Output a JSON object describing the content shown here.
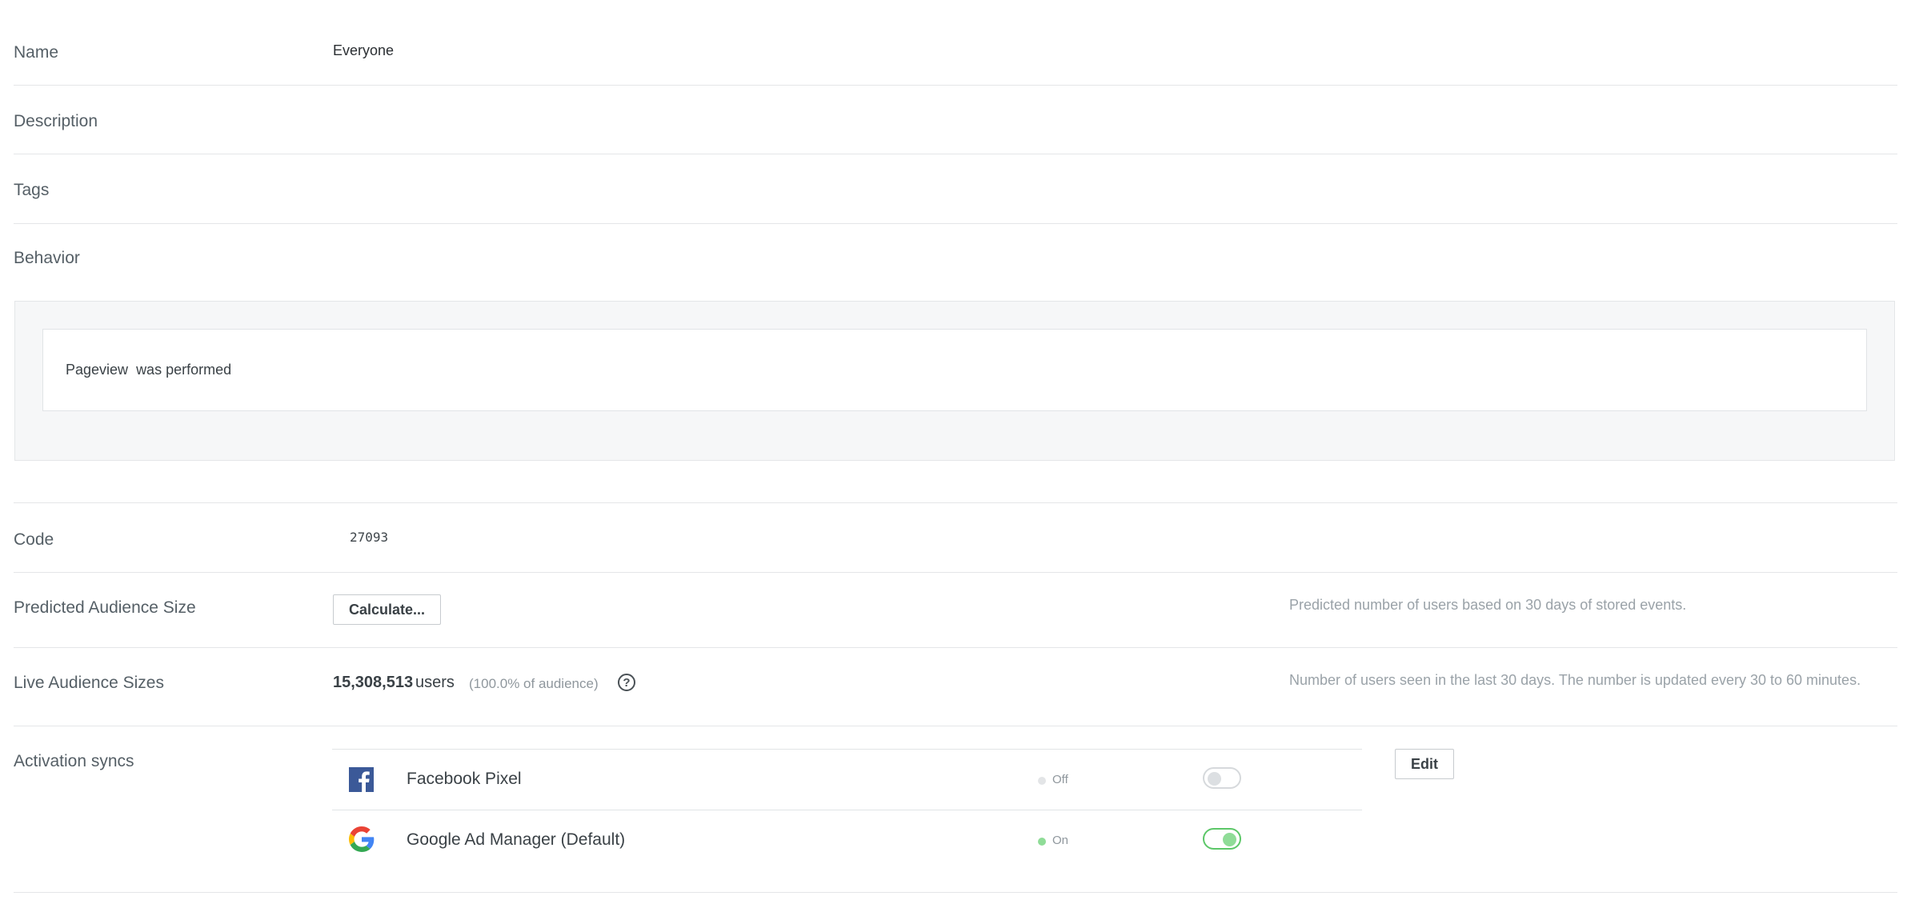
{
  "fields": {
    "name": {
      "label": "Name",
      "value": "Everyone"
    },
    "description": {
      "label": "Description"
    },
    "tags": {
      "label": "Tags"
    },
    "behavior": {
      "label": "Behavior",
      "rule_event": "Pageview",
      "rule_text": "was performed"
    },
    "code": {
      "label": "Code",
      "value": "27093"
    },
    "predicted_size": {
      "label": "Predicted Audience Size",
      "button_label": "Calculate...",
      "hint": "Predicted number of users based on 30 days of stored events."
    },
    "live_size": {
      "label": "Live Audience Sizes",
      "count": "15,308,513",
      "unit": "users",
      "percent_text": "(100.0% of audience)",
      "help_icon": "?",
      "hint": "Number of users seen in the last 30 days. The number is updated every 30 to 60 minutes."
    },
    "activation_syncs": {
      "label": "Activation syncs",
      "edit_label": "Edit",
      "items": [
        {
          "name": "Facebook Pixel",
          "icon": "facebook-icon",
          "status": "Off",
          "enabled": false,
          "dot_color": "#e3e5e7"
        },
        {
          "name": "Google Ad Manager (Default)",
          "icon": "google-icon",
          "status": "On",
          "enabled": true,
          "dot_color": "#8fdc97"
        }
      ]
    }
  },
  "colors": {
    "toggle_on": "#5cc768",
    "facebook": "#3b5998"
  }
}
